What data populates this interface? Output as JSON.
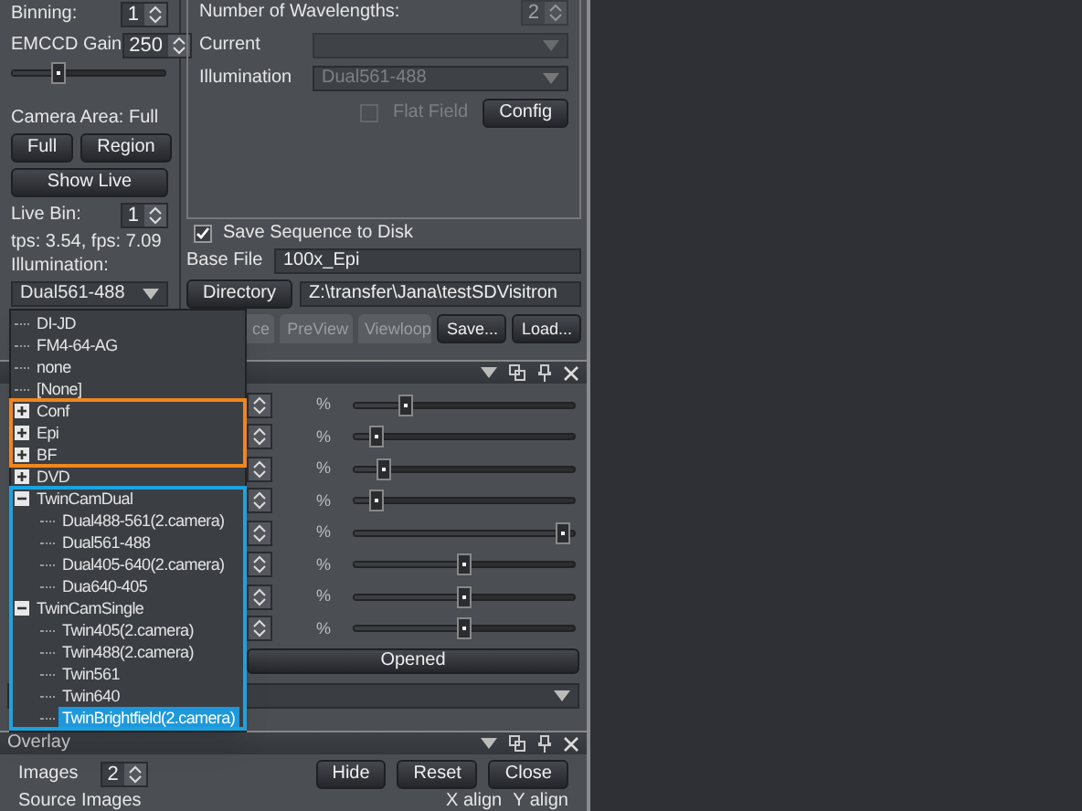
{
  "left_panel": {
    "binning": {
      "label": "Binning:",
      "value": "1"
    },
    "gain": {
      "label": "EMCCD Gain",
      "value": "250",
      "level": 0.28
    },
    "camera_area": "Camera Area: Full",
    "area_buttons": [
      "Full",
      "Region"
    ],
    "show_live": "Show Live",
    "live_bin": {
      "label": "Live Bin:",
      "value": "1"
    },
    "rate": "tps: 3.54, fps: 7.09",
    "illumination": {
      "label": "Illumination:",
      "value": "Dual561-488"
    }
  },
  "wavelengths": {
    "label": "Number of Wavelengths:",
    "value": "2",
    "disabled": true
  },
  "current": {
    "label": "Current",
    "disabled": true
  },
  "illumination": {
    "label": "Illumination",
    "value": "Dual561-488",
    "disabled": true
  },
  "flat_field": {
    "label": "Flat Field",
    "checked": false,
    "disabled": true
  },
  "config_button": "Config",
  "save_sequence": {
    "label": "Save Sequence to Disk",
    "checked": true
  },
  "base_file": {
    "label": "Base File",
    "value": "100x_Epi"
  },
  "directory": {
    "button": "Directory",
    "value": "Z:\\transfer\\Jana\\testSDVisitron"
  },
  "tabs": [
    {
      "label": "ce",
      "selected": false
    },
    {
      "label": "PreView",
      "selected": false
    },
    {
      "label": "Viewloop",
      "selected": false
    }
  ],
  "actions": [
    "Save...",
    "Load..."
  ],
  "channels": [
    {
      "unit": "%",
      "level": 0.21
    },
    {
      "unit": "%",
      "level": 0.07
    },
    {
      "unit": "%",
      "level": 0.11
    },
    {
      "unit": "%",
      "level": 0.07
    },
    {
      "unit": "%",
      "level": 0.98
    },
    {
      "unit": "%",
      "level": 0.5
    },
    {
      "unit": "%",
      "level": 0.5
    },
    {
      "unit": "%",
      "level": 0.5
    }
  ],
  "opened_button": "Opened",
  "overlay": {
    "title": "Overlay",
    "images": {
      "label": "Images",
      "value": "2"
    },
    "buttons": [
      "Hide",
      "Reset",
      "Close"
    ],
    "source_label": "Source Images",
    "columns": [
      "X align",
      "Y align"
    ]
  },
  "dropdown_list": {
    "sections": [
      {
        "items": [
          {
            "label": "DI-JD",
            "selected": false
          },
          {
            "label": "FM4-64-AG",
            "selected": false
          },
          {
            "label": "none",
            "selected": false
          },
          {
            "label": "[None]",
            "selected": false
          }
        ]
      },
      {
        "color": "#f0861c",
        "items": [
          {
            "label": "Conf",
            "expanded": false,
            "selected": false
          },
          {
            "label": "Epi",
            "expanded": false,
            "selected": false
          },
          {
            "label": "BF",
            "expanded": false,
            "selected": false
          }
        ]
      },
      {
        "items": [
          {
            "label": "DVD",
            "expanded": false,
            "selected": false
          }
        ]
      },
      {
        "color": "#1ea2de",
        "items": [
          {
            "label": "TwinCamDual",
            "expanded": true,
            "selected": false,
            "children": [
              {
                "label": "Dual488-561(2.camera)",
                "selected": false
              },
              {
                "label": "Dual561-488",
                "selected": false
              },
              {
                "label": "Dual405-640(2.camera)",
                "selected": false
              },
              {
                "label": "Dua640-405",
                "selected": false
              }
            ]
          },
          {
            "label": "TwinCamSingle",
            "expanded": true,
            "selected": false,
            "children": [
              {
                "label": "Twin405(2.camera)",
                "selected": false
              },
              {
                "label": "Twin488(2.camera)",
                "selected": false
              },
              {
                "label": "Twin561",
                "selected": false
              },
              {
                "label": "Twin640",
                "selected": false
              },
              {
                "label": "TwinBrightfield(2.camera)",
                "selected": true
              }
            ]
          }
        ]
      }
    ]
  }
}
